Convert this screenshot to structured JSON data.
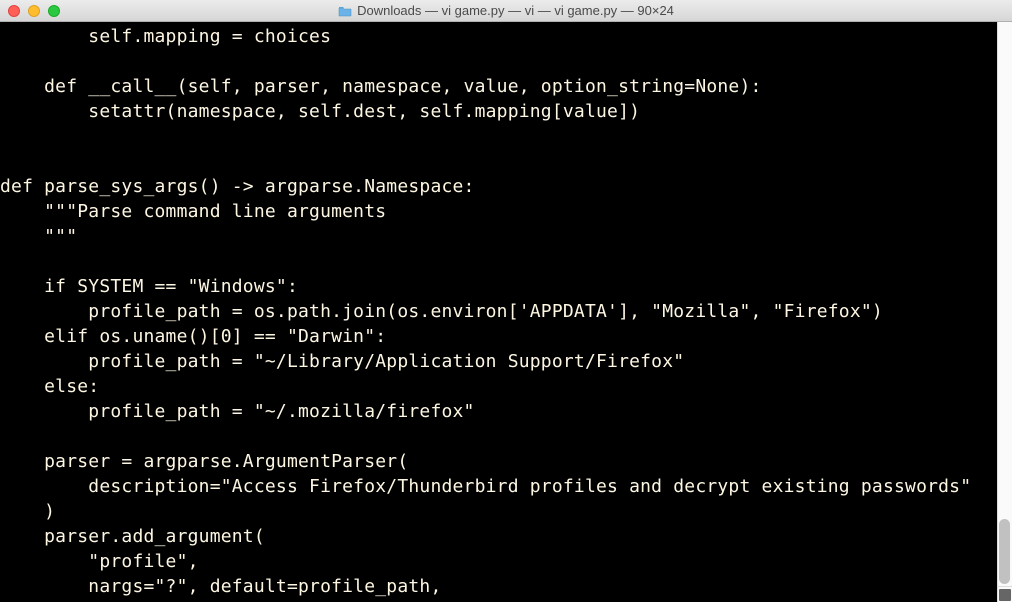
{
  "window": {
    "title": "Downloads — vi game.py — vi — vi game.py — 90×24"
  },
  "code": {
    "lines": [
      "        self.mapping = choices",
      "",
      "    def __call__(self, parser, namespace, value, option_string=None):",
      "        setattr(namespace, self.dest, self.mapping[value])",
      "",
      "",
      "def parse_sys_args() -> argparse.Namespace:",
      "    \"\"\"Parse command line arguments",
      "    \"\"\"",
      "",
      "    if SYSTEM == \"Windows\":",
      "        profile_path = os.path.join(os.environ['APPDATA'], \"Mozilla\", \"Firefox\")",
      "    elif os.uname()[0] == \"Darwin\":",
      "        profile_path = \"~/Library/Application Support/Firefox\"",
      "    else:",
      "        profile_path = \"~/.mozilla/firefox\"",
      "",
      "    parser = argparse.ArgumentParser(",
      "        description=\"Access Firefox/Thunderbird profiles and decrypt existing passwords\"",
      "    )",
      "    parser.add_argument(",
      "        \"profile\",",
      "        nargs=\"?\", default=profile_path,"
    ]
  }
}
